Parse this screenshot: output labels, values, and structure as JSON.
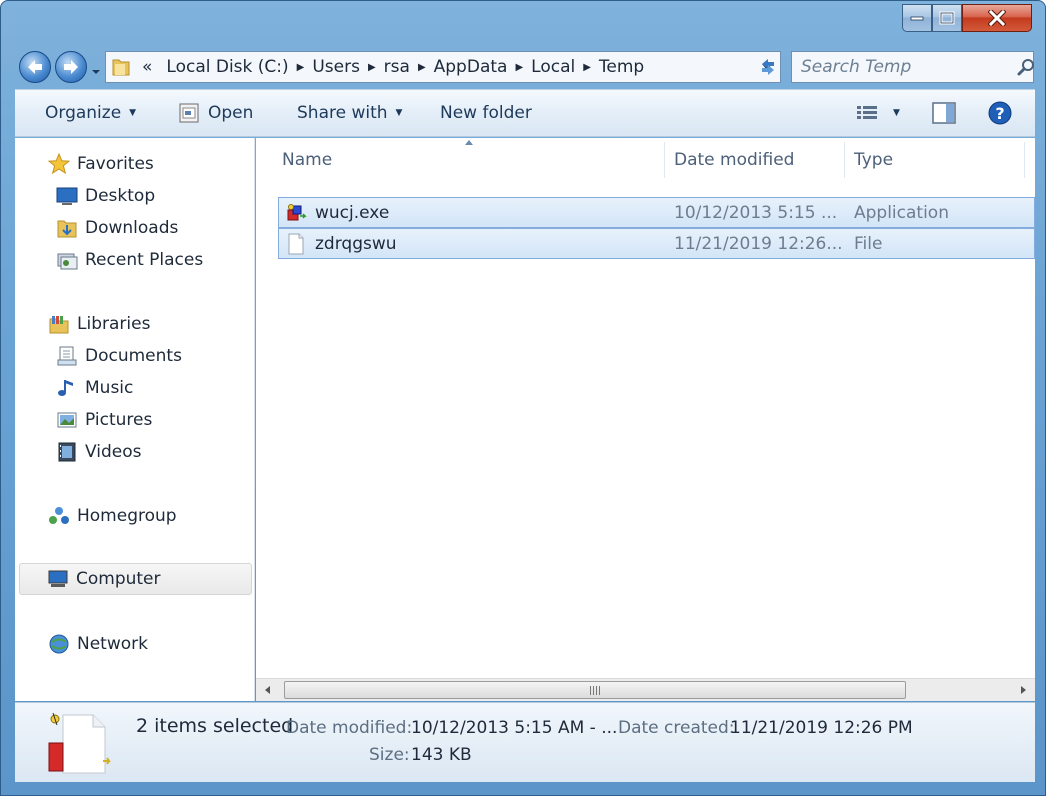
{
  "window": {
    "caption": {
      "minimize_icon": "minimize-icon",
      "maximize_icon": "maximize-icon",
      "close_icon": "close-icon"
    }
  },
  "address": {
    "overflow": "«",
    "crumbs": [
      "Local Disk (C:)",
      "Users",
      "rsa",
      "AppData",
      "Local",
      "Temp"
    ]
  },
  "search": {
    "placeholder": "Search Temp"
  },
  "toolbar": {
    "organize": "Organize",
    "open": "Open",
    "share_with": "Share with",
    "new_folder": "New folder"
  },
  "nav": {
    "favorites": "Favorites",
    "desktop": "Desktop",
    "downloads": "Downloads",
    "recent_places": "Recent Places",
    "libraries": "Libraries",
    "documents": "Documents",
    "music": "Music",
    "pictures": "Pictures",
    "videos": "Videos",
    "homegroup": "Homegroup",
    "computer": "Computer",
    "network": "Network"
  },
  "columns": {
    "name": "Name",
    "date_modified": "Date modified",
    "type": "Type"
  },
  "files": [
    {
      "name": "wucj.exe",
      "date": "10/12/2013 5:15 ...",
      "type": "Application",
      "icon": "application-icon"
    },
    {
      "name": "zdrqgswu",
      "date": "11/21/2019 12:26...",
      "type": "File",
      "icon": "file-icon"
    }
  ],
  "details": {
    "count": "2 items selected",
    "date_modified_label": "Date modified:",
    "date_modified_value": "10/12/2013 5:15 AM - ...",
    "date_created_label": "Date created:",
    "date_created_value": "11/21/2019 12:26 PM",
    "size_label": "Size:",
    "size_value": "143 KB"
  },
  "colors": {
    "frame": "#6aa3d4",
    "selection": "#d3e5f8",
    "selection_border": "#84acdd"
  }
}
